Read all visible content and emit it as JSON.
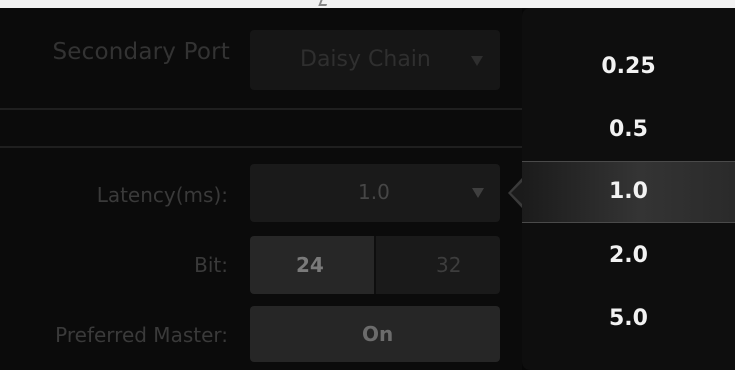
{
  "settings": {
    "secondary_port": {
      "label": "Secondary Port",
      "value": "Daisy Chain"
    },
    "latency": {
      "label": "Latency(ms):",
      "value": "1.0"
    },
    "bit": {
      "label": "Bit:",
      "options": [
        "24",
        "32"
      ],
      "selected": "24"
    },
    "preferred_master": {
      "label": "Preferred Master:",
      "value": "On"
    }
  },
  "latency_popup": {
    "options": [
      "0.25",
      "0.5",
      "1.0",
      "2.0",
      "5.0"
    ],
    "selected": "1.0"
  },
  "colors": {
    "popup_text": "#f2f2f2",
    "highlight": "#343434",
    "background": "#0b0b0b"
  }
}
